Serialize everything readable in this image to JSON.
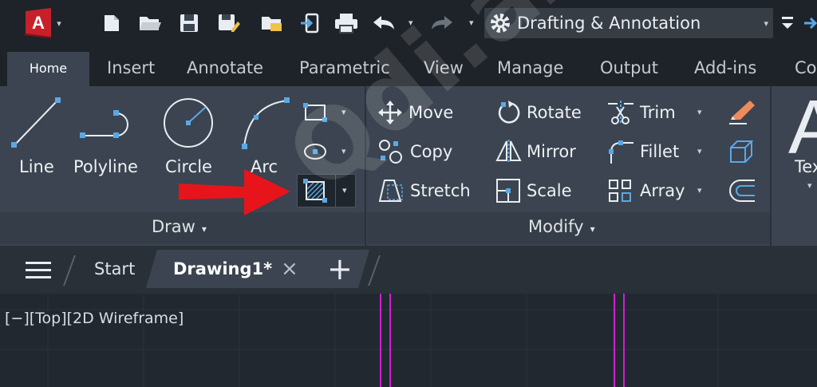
{
  "colors": {
    "app_red": "#c8202b",
    "accent_blue": "#5aa8e6",
    "arrow_red": "#e8141c",
    "magenta_line": "#d21ed2"
  },
  "app": {
    "logo_letter": "A",
    "workspace": "Drafting & Annotation"
  },
  "tabs": [
    {
      "label": "Home"
    },
    {
      "label": "Insert"
    },
    {
      "label": "Annotate"
    },
    {
      "label": "Parametric"
    },
    {
      "label": "View"
    },
    {
      "label": "Manage"
    },
    {
      "label": "Output"
    },
    {
      "label": "Add-ins"
    },
    {
      "label": "Co"
    }
  ],
  "draw_panel": {
    "title": "Draw",
    "tools": [
      {
        "label": "Line",
        "icon": "line-icon"
      },
      {
        "label": "Polyline",
        "icon": "polyline-icon"
      },
      {
        "label": "Circle",
        "icon": "circle-icon"
      },
      {
        "label": "Arc",
        "icon": "arc-icon"
      }
    ],
    "small_tools": [
      "rectangle-icon",
      "ellipse-icon",
      "hatch-icon"
    ]
  },
  "modify_panel": {
    "title": "Modify",
    "tools": [
      {
        "label": "Move",
        "icon": "move-icon"
      },
      {
        "label": "Rotate",
        "icon": "rotate-icon"
      },
      {
        "label": "Trim",
        "icon": "trim-icon"
      },
      {
        "label": "Copy",
        "icon": "copy-icon"
      },
      {
        "label": "Mirror",
        "icon": "mirror-icon"
      },
      {
        "label": "Fillet",
        "icon": "fillet-icon"
      },
      {
        "label": "Stretch",
        "icon": "stretch-icon"
      },
      {
        "label": "Scale",
        "icon": "scale-icon"
      },
      {
        "label": "Array",
        "icon": "array-icon"
      }
    ]
  },
  "text_panel": {
    "label": "Tex",
    "glyph": "A"
  },
  "doc_tabs": {
    "start": "Start",
    "active": "Drawing1*",
    "close": "×",
    "new": "+"
  },
  "viewport": {
    "label": "[−][Top][2D Wireframe]"
  },
  "watermark": "Qdi.az"
}
